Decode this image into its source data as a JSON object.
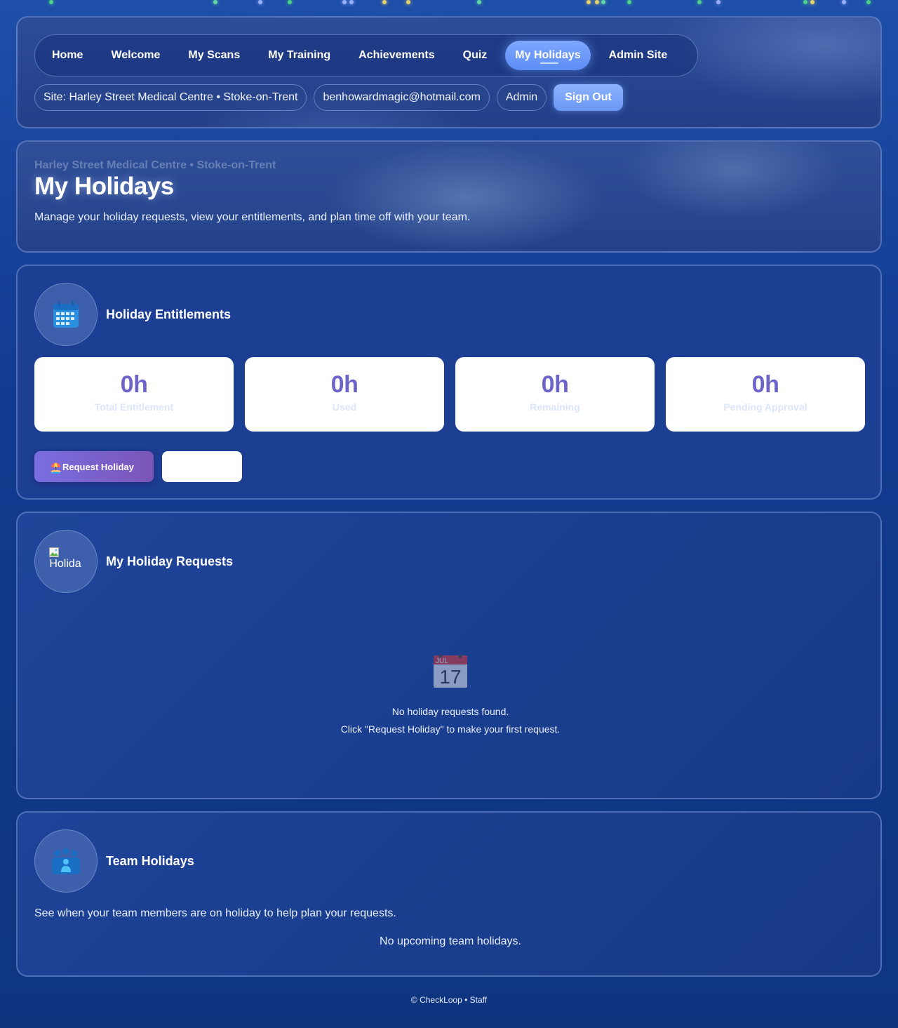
{
  "nav": {
    "items": [
      {
        "label": "Home",
        "active": false
      },
      {
        "label": "Welcome",
        "active": false
      },
      {
        "label": "My Scans",
        "active": false
      },
      {
        "label": "My Training",
        "active": false
      },
      {
        "label": "Achievements",
        "active": false
      },
      {
        "label": "Quiz",
        "active": false
      },
      {
        "label": "My Holidays",
        "active": true
      },
      {
        "label": "Admin Site",
        "active": false
      }
    ],
    "site_label": "Site: Harley Street Medical Centre • Stoke-on-Trent",
    "email": "benhowardmagic@hotmail.com",
    "role": "Admin",
    "sign_out": "Sign Out"
  },
  "hero": {
    "site": "Harley Street Medical Centre • Stoke-on-Trent",
    "title": "My Holidays",
    "description": "Manage your holiday requests, view your entitlements, and plan time off with your team."
  },
  "entitlements": {
    "icon": "calendar-icon",
    "title": "Holiday Entitlements",
    "stats": [
      {
        "value": "0h",
        "label": "Total Entitlement"
      },
      {
        "value": "0h",
        "label": "Used"
      },
      {
        "value": "0h",
        "label": "Remaining"
      },
      {
        "value": "0h",
        "label": "Pending Approval"
      }
    ],
    "request_button": "Request Holiday",
    "request_button_icon": "beach-umbrella-icon"
  },
  "requests": {
    "icon_alt": "Holida",
    "title": "My Holiday Requests",
    "empty_icon": "calendar-date-icon",
    "empty_icon_month": "JUL",
    "empty_icon_day": "17",
    "empty_line1": "No holiday requests found.",
    "empty_line2": "Click \"Request Holiday\" to make your first request."
  },
  "team": {
    "icon": "team-icon",
    "title": "Team Holidays",
    "description": "See when your team members are on holiday to help plan your requests.",
    "empty": "No upcoming team holidays."
  },
  "footer": "© CheckLoop • Staff"
}
